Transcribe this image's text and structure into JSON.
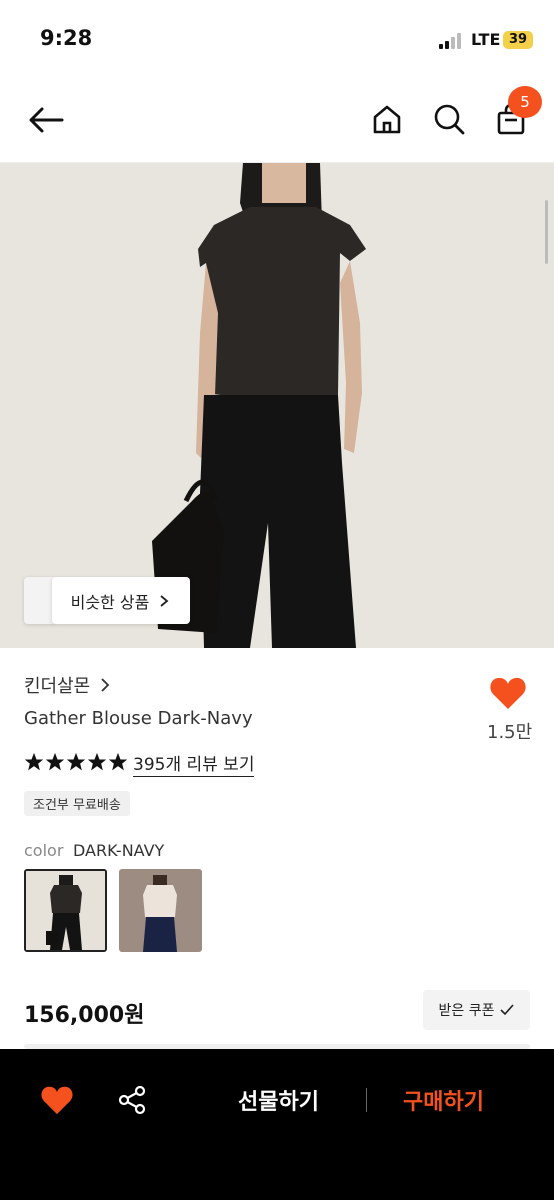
{
  "status_bar": {
    "time": "9:28",
    "network": "LTE",
    "battery": "39"
  },
  "header": {
    "cart_count": "5"
  },
  "hero": {
    "similar_button_label": "비슷한 상품"
  },
  "product": {
    "brand": "킨더살몬",
    "name": "Gather Blouse Dark-Navy",
    "like_count": "1.5만",
    "rating_stars": 5,
    "review_link": "395개 리뷰 보기",
    "shipping_badge": "조건부 무료배송",
    "color_label": "color",
    "color_value": "DARK-NAVY",
    "price": "156,000원",
    "coupon_label": "받은 쿠폰"
  },
  "bottom_bar": {
    "gift_label": "선물하기",
    "buy_label": "구매하기"
  },
  "colors": {
    "accent": "#f4511e",
    "bar_bg": "#000000"
  }
}
